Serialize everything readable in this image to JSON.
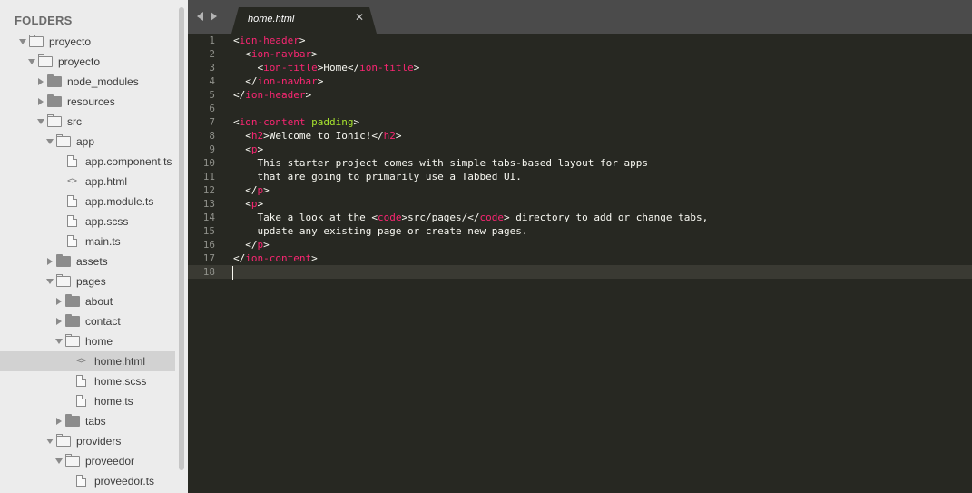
{
  "sidebar": {
    "title": "FOLDERS",
    "tree": [
      {
        "label": "proyecto",
        "type": "folder",
        "open": true,
        "depth": 0
      },
      {
        "label": "proyecto",
        "type": "folder",
        "open": true,
        "depth": 1
      },
      {
        "label": "node_modules",
        "type": "folder",
        "open": false,
        "depth": 2
      },
      {
        "label": "resources",
        "type": "folder",
        "open": false,
        "depth": 2
      },
      {
        "label": "src",
        "type": "folder",
        "open": true,
        "depth": 2
      },
      {
        "label": "app",
        "type": "folder",
        "open": true,
        "depth": 3
      },
      {
        "label": "app.component.ts",
        "type": "file",
        "icon": "file-icon",
        "depth": 4
      },
      {
        "label": "app.html",
        "type": "file",
        "icon": "code-file-icon",
        "depth": 4
      },
      {
        "label": "app.module.ts",
        "type": "file",
        "icon": "file-icon",
        "depth": 4
      },
      {
        "label": "app.scss",
        "type": "file",
        "icon": "file-icon",
        "depth": 4
      },
      {
        "label": "main.ts",
        "type": "file",
        "icon": "file-icon",
        "depth": 4
      },
      {
        "label": "assets",
        "type": "folder",
        "open": false,
        "depth": 3
      },
      {
        "label": "pages",
        "type": "folder",
        "open": true,
        "depth": 3
      },
      {
        "label": "about",
        "type": "folder",
        "open": false,
        "depth": 4
      },
      {
        "label": "contact",
        "type": "folder",
        "open": false,
        "depth": 4
      },
      {
        "label": "home",
        "type": "folder",
        "open": true,
        "depth": 4
      },
      {
        "label": "home.html",
        "type": "file",
        "icon": "code-file-icon",
        "depth": 5,
        "selected": true
      },
      {
        "label": "home.scss",
        "type": "file",
        "icon": "file-icon",
        "depth": 5
      },
      {
        "label": "home.ts",
        "type": "file",
        "icon": "file-icon",
        "depth": 5
      },
      {
        "label": "tabs",
        "type": "folder",
        "open": false,
        "depth": 4
      },
      {
        "label": "providers",
        "type": "folder",
        "open": true,
        "depth": 3
      },
      {
        "label": "proveedor",
        "type": "folder",
        "open": true,
        "depth": 4
      },
      {
        "label": "proveedor.ts",
        "type": "file",
        "icon": "file-icon",
        "depth": 5
      }
    ]
  },
  "tabs": [
    {
      "label": "home.html",
      "close_glyph": "✕",
      "active": true
    }
  ],
  "editor": {
    "current_line": 18,
    "lines": [
      {
        "num": "1",
        "tokens": [
          {
            "t": "p",
            "v": "<"
          },
          {
            "t": "tag",
            "v": "ion-header"
          },
          {
            "t": "p",
            "v": ">"
          }
        ]
      },
      {
        "num": "2",
        "tokens": [
          {
            "t": "p",
            "v": "  <"
          },
          {
            "t": "tag",
            "v": "ion-navbar"
          },
          {
            "t": "p",
            "v": ">"
          }
        ]
      },
      {
        "num": "3",
        "tokens": [
          {
            "t": "p",
            "v": "    <"
          },
          {
            "t": "tag",
            "v": "ion-title"
          },
          {
            "t": "p",
            "v": ">Home</"
          },
          {
            "t": "tag",
            "v": "ion-title"
          },
          {
            "t": "p",
            "v": ">"
          }
        ]
      },
      {
        "num": "4",
        "tokens": [
          {
            "t": "p",
            "v": "  </"
          },
          {
            "t": "tag",
            "v": "ion-navbar"
          },
          {
            "t": "p",
            "v": ">"
          }
        ]
      },
      {
        "num": "5",
        "tokens": [
          {
            "t": "p",
            "v": "</"
          },
          {
            "t": "tag",
            "v": "ion-header"
          },
          {
            "t": "p",
            "v": ">"
          }
        ]
      },
      {
        "num": "6",
        "tokens": []
      },
      {
        "num": "7",
        "tokens": [
          {
            "t": "p",
            "v": "<"
          },
          {
            "t": "tag",
            "v": "ion-content"
          },
          {
            "t": "p",
            "v": " "
          },
          {
            "t": "attr",
            "v": "padding"
          },
          {
            "t": "p",
            "v": ">"
          }
        ]
      },
      {
        "num": "8",
        "tokens": [
          {
            "t": "p",
            "v": "  <"
          },
          {
            "t": "tag",
            "v": "h2"
          },
          {
            "t": "p",
            "v": ">Welcome to Ionic!</"
          },
          {
            "t": "tag",
            "v": "h2"
          },
          {
            "t": "p",
            "v": ">"
          }
        ]
      },
      {
        "num": "9",
        "tokens": [
          {
            "t": "p",
            "v": "  <"
          },
          {
            "t": "tag",
            "v": "p"
          },
          {
            "t": "p",
            "v": ">"
          }
        ]
      },
      {
        "num": "10",
        "tokens": [
          {
            "t": "p",
            "v": "    This starter project comes with simple tabs-based layout for apps"
          }
        ]
      },
      {
        "num": "11",
        "tokens": [
          {
            "t": "p",
            "v": "    that are going to primarily use a Tabbed UI."
          }
        ]
      },
      {
        "num": "12",
        "tokens": [
          {
            "t": "p",
            "v": "  </"
          },
          {
            "t": "tag",
            "v": "p"
          },
          {
            "t": "p",
            "v": ">"
          }
        ]
      },
      {
        "num": "13",
        "tokens": [
          {
            "t": "p",
            "v": "  <"
          },
          {
            "t": "tag",
            "v": "p"
          },
          {
            "t": "p",
            "v": ">"
          }
        ]
      },
      {
        "num": "14",
        "tokens": [
          {
            "t": "p",
            "v": "    Take a look at the <"
          },
          {
            "t": "tag",
            "v": "code"
          },
          {
            "t": "p",
            "v": ">src/pages/</"
          },
          {
            "t": "tag",
            "v": "code"
          },
          {
            "t": "p",
            "v": "> directory to add or change tabs,"
          }
        ]
      },
      {
        "num": "15",
        "tokens": [
          {
            "t": "p",
            "v": "    update any existing page or create new pages."
          }
        ]
      },
      {
        "num": "16",
        "tokens": [
          {
            "t": "p",
            "v": "  </"
          },
          {
            "t": "tag",
            "v": "p"
          },
          {
            "t": "p",
            "v": ">"
          }
        ]
      },
      {
        "num": "17",
        "tokens": [
          {
            "t": "p",
            "v": "</"
          },
          {
            "t": "tag",
            "v": "ion-content"
          },
          {
            "t": "p",
            "v": ">"
          }
        ]
      },
      {
        "num": "18",
        "tokens": []
      }
    ]
  },
  "colors": {
    "editor_bg": "#272822",
    "tag": "#f92672",
    "attribute": "#a6e22e",
    "text": "#f8f8f2",
    "line_number": "#8f908a",
    "sidebar_bg": "#ececec",
    "tabbar_bg": "#4b4b4b"
  }
}
